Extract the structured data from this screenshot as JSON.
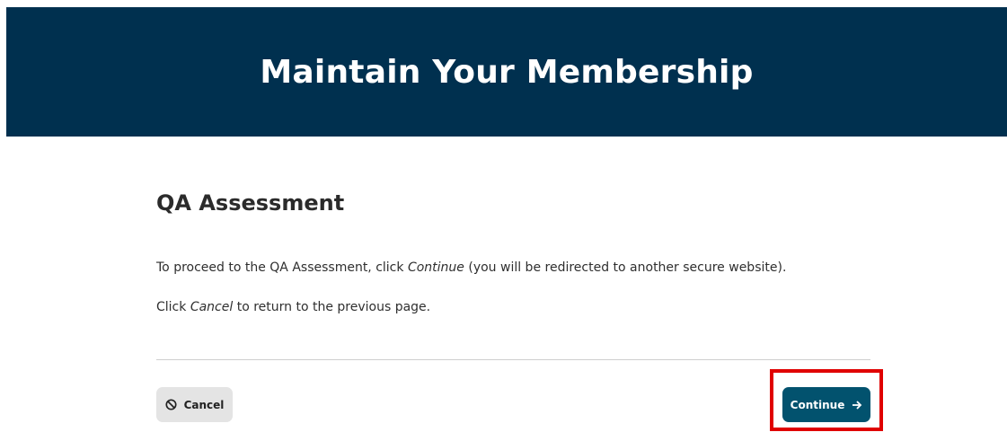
{
  "header": {
    "title": "Maintain Your Membership"
  },
  "main": {
    "section_title": "QA Assessment",
    "paragraph_1": {
      "before": "To proceed to the QA Assessment, click ",
      "emphasis": "Continue",
      "after": " (you will be redirected to another secure website)."
    },
    "paragraph_2": {
      "before": "Click ",
      "emphasis": "Cancel",
      "after": " to return to the previous page."
    }
  },
  "actions": {
    "cancel_label": "Cancel",
    "continue_label": "Continue",
    "cancel_icon": "ban-icon",
    "continue_icon": "arrow-right-icon"
  },
  "colors": {
    "header_bg": "#00304f",
    "continue_bg": "#02526e",
    "cancel_bg": "#e4e4e4",
    "highlight": "#e00000"
  }
}
